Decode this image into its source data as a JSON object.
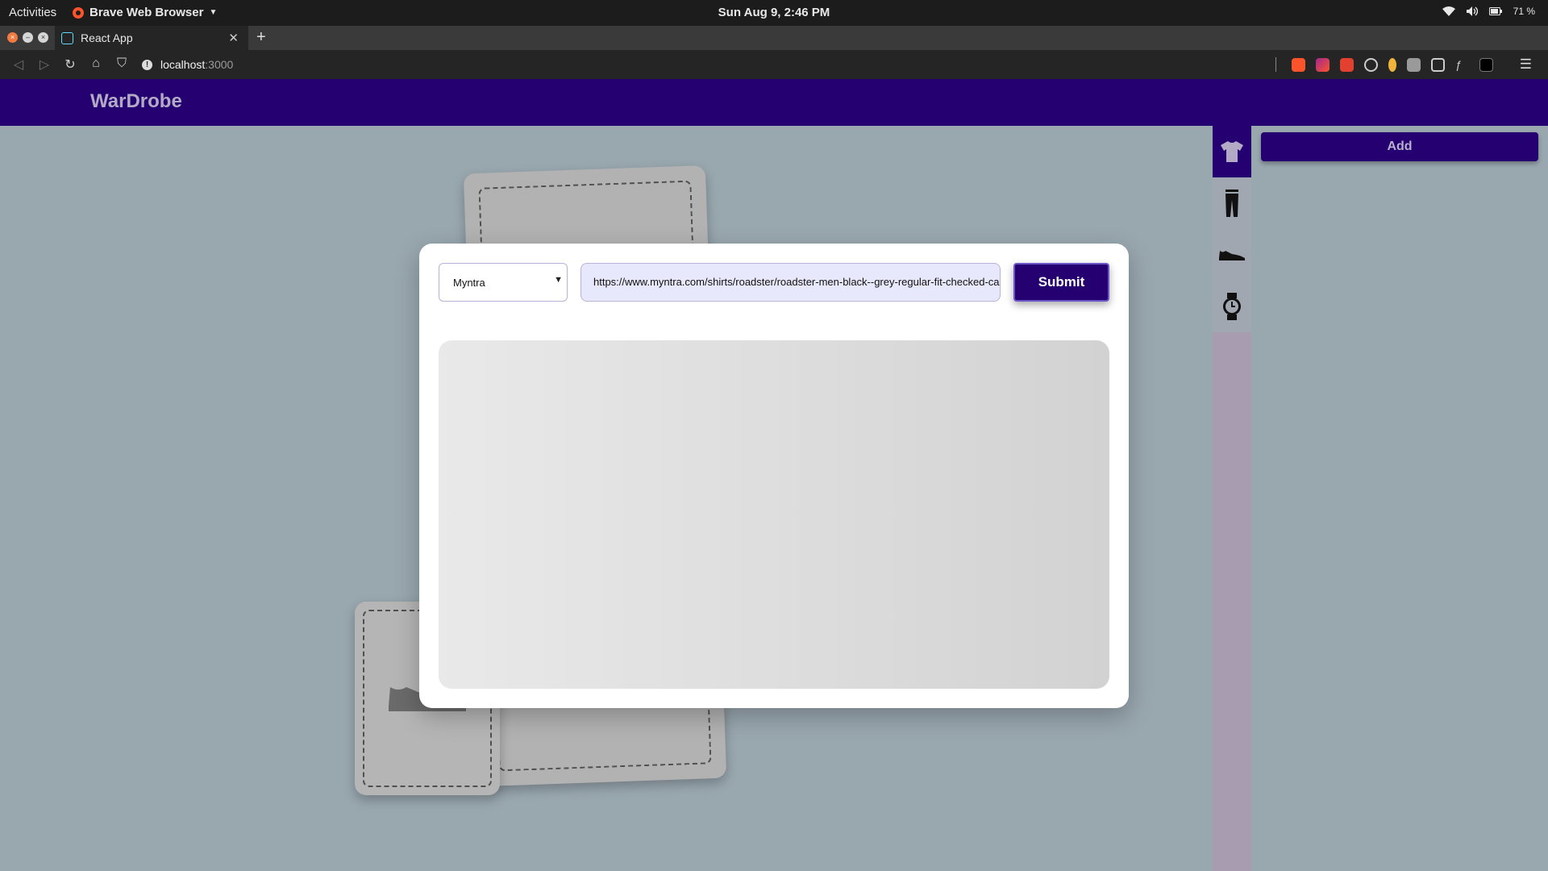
{
  "system_bar": {
    "activities": "Activities",
    "app_name": "Brave Web Browser",
    "clock": "Sun Aug  9,  2:46 PM",
    "battery": "71 %"
  },
  "browser": {
    "tab_title": "React App",
    "url_host": "localhost",
    "url_port": ":3000"
  },
  "app": {
    "logo": "WarDrobe"
  },
  "modal": {
    "store_selected": "Myntra",
    "url_value": "https://www.myntra.com/shirts/roadster/roadster-men-black--grey-regular-fit-checked-casual-shirt",
    "submit_label": "Submit"
  },
  "sidebar": {
    "items": [
      {
        "icon": "tshirt-icon",
        "active": true
      },
      {
        "icon": "pants-icon",
        "active": false
      },
      {
        "icon": "shoe-icon",
        "active": false
      },
      {
        "icon": "watch-icon",
        "active": false
      }
    ],
    "add_label": "Add"
  },
  "colors": {
    "brand": "#250070",
    "background": "#99a7af",
    "input_bg": "#e8e8fc"
  }
}
